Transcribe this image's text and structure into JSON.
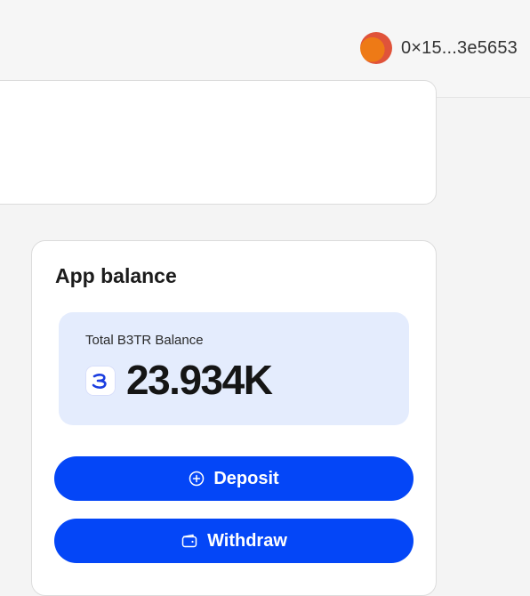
{
  "header": {
    "wallet": {
      "address": "0×15...3e5653",
      "avatar_colors": [
        "#ee7a16",
        "#e0533a"
      ]
    }
  },
  "app_balance": {
    "title": "App balance",
    "balance_label": "Total B3TR Balance",
    "balance_value": "23.934K",
    "token_icon": "b3tr-token-icon",
    "actions": {
      "deposit_label": "Deposit",
      "deposit_icon": "plus-circle-icon",
      "withdraw_label": "Withdraw",
      "withdraw_icon": "wallet-icon"
    }
  },
  "colors": {
    "primary_button": "#0446f7",
    "balance_box": "#e4ecfd",
    "background": "#f4f4f4",
    "card": "#ffffff"
  }
}
